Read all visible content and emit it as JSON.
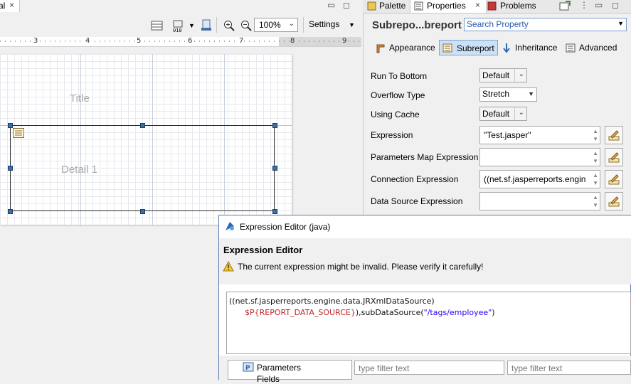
{
  "left_editor": {
    "tab_label": "al",
    "tab_close": "×",
    "zoom": "100%",
    "settings_label": "Settings",
    "ruler_numbers": [
      "3",
      "4",
      "5",
      "6",
      "7",
      "8",
      "9"
    ],
    "bands": {
      "title": "Title",
      "detail": "Detail 1"
    }
  },
  "properties_view": {
    "tabs": [
      {
        "label": "Palette",
        "icon": "palette-icon"
      },
      {
        "label": "Properties",
        "icon": "properties-icon",
        "active": true
      },
      {
        "label": "Problems",
        "icon": "problems-icon"
      }
    ],
    "element_title": "Subrepo...breport",
    "search_placeholder": "Search Property",
    "section_tabs": [
      {
        "label": "Appearance",
        "icon": "appearance-icon"
      },
      {
        "label": "Subreport",
        "icon": "subreport-icon",
        "active": true
      },
      {
        "label": "Inheritance",
        "icon": "inheritance-icon"
      },
      {
        "label": "Advanced",
        "icon": "advanced-icon"
      }
    ],
    "properties": {
      "run_to_bottom": {
        "label": "Run To Bottom",
        "value": "Default"
      },
      "overflow_type": {
        "label": "Overflow Type",
        "value": "Stretch"
      },
      "using_cache": {
        "label": "Using Cache",
        "value": "Default"
      },
      "expression": {
        "label": "Expression",
        "value": "\"Test.jasper\""
      },
      "parameters_map_expression": {
        "label": "Parameters Map Expression",
        "value": ""
      },
      "connection_expression": {
        "label": "Connection Expression",
        "value": "((net.sf.jasperreports.engin"
      },
      "data_source_expression": {
        "label": "Data Source Expression",
        "value": ""
      }
    }
  },
  "dialog": {
    "title": "Expression Editor (java)",
    "heading": "Expression Editor",
    "warning": "The current expression might be invalid. Please verify it carefully!",
    "code_line1": "((net.sf.jasperreports.engine.data.JRXmlDataSource)",
    "code_param": "$P{REPORT_DATA_SOURCE}",
    "code_mid": "),subDataSource(",
    "code_string": "\"/tags/employee\"",
    "code_end": ")",
    "tree_items": [
      "Parameters",
      "Fields"
    ],
    "filter_placeholder_1": "type filter text",
    "filter_placeholder_2": "type filter text"
  },
  "colors": {
    "accent": "#3a6ea5",
    "selected_tab": "#cde0f5",
    "param": "#c0282d",
    "string": "#2a00ff"
  }
}
